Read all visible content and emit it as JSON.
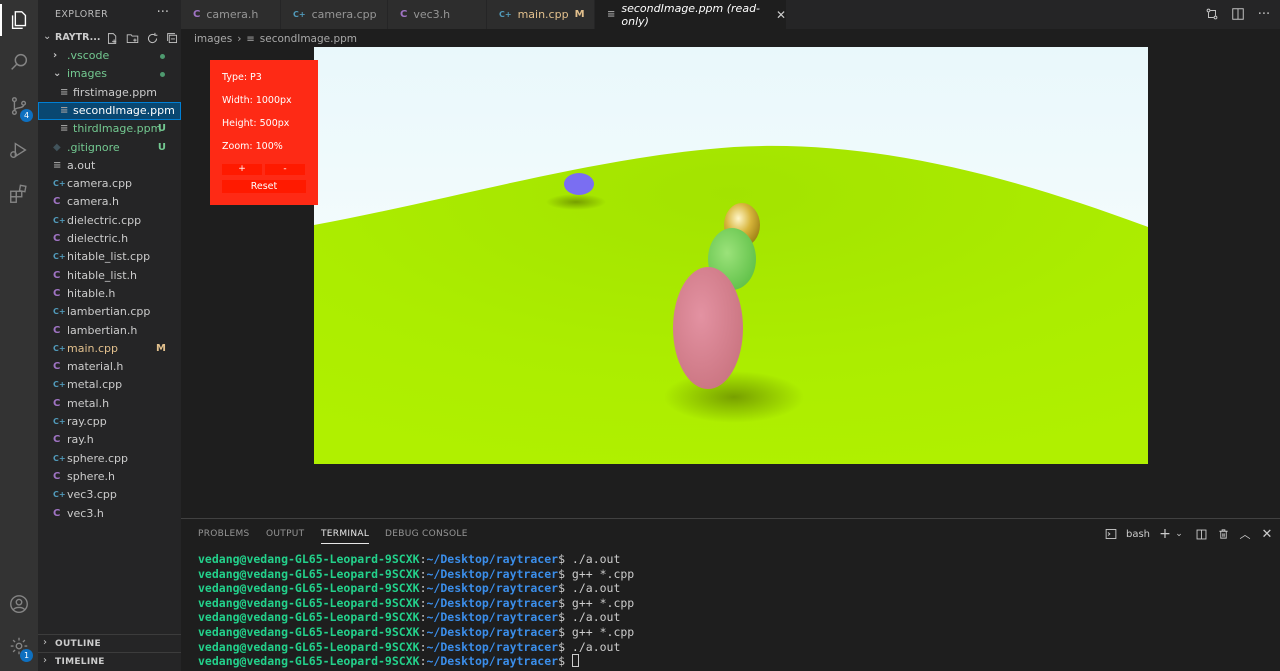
{
  "activity_bar": {
    "items": [
      {
        "icon": "files-icon"
      },
      {
        "icon": "search-icon"
      },
      {
        "icon": "source-control-icon",
        "badge": "4"
      },
      {
        "icon": "run-debug-icon"
      },
      {
        "icon": "extensions-icon"
      }
    ],
    "account_icon": "account-icon",
    "settings_icon": "settings-gear-icon",
    "settings_badge": "1"
  },
  "sidebar": {
    "title": "EXPLORER",
    "more": "···",
    "project": "RAYTR...",
    "outline": "OUTLINE",
    "timeline": "TIMELINE",
    "tree": [
      {
        "label": ".vscode",
        "type": "folder",
        "indent": 1,
        "status": "dot",
        "color": "#73c991"
      },
      {
        "label": "images",
        "type": "folder-open",
        "indent": 1,
        "status": "dot",
        "color": "#73c991"
      },
      {
        "label": "firstimage.ppm",
        "type": "file",
        "indent": 2,
        "status": "",
        "color": "#cccccc"
      },
      {
        "label": "secondImage.ppm",
        "type": "file",
        "indent": 2,
        "status": "",
        "color": "#ffffff",
        "selected": true
      },
      {
        "label": "thirdImage.ppm",
        "type": "file",
        "indent": 2,
        "status": "U",
        "color": "#73c991"
      },
      {
        "label": ".gitignore",
        "type": "gitignore",
        "indent": 1,
        "status": "U",
        "color": "#73c991"
      },
      {
        "label": "a.out",
        "type": "file",
        "indent": 1,
        "status": "",
        "color": "#cccccc"
      },
      {
        "label": "camera.cpp",
        "type": "cpp",
        "indent": 1,
        "status": "",
        "color": "#cccccc"
      },
      {
        "label": "camera.h",
        "type": "c",
        "indent": 1,
        "status": "",
        "color": "#cccccc"
      },
      {
        "label": "dielectric.cpp",
        "type": "cpp",
        "indent": 1,
        "status": "",
        "color": "#cccccc"
      },
      {
        "label": "dielectric.h",
        "type": "c",
        "indent": 1,
        "status": "",
        "color": "#cccccc"
      },
      {
        "label": "hitable_list.cpp",
        "type": "cpp",
        "indent": 1,
        "status": "",
        "color": "#cccccc"
      },
      {
        "label": "hitable_list.h",
        "type": "c",
        "indent": 1,
        "status": "",
        "color": "#cccccc"
      },
      {
        "label": "hitable.h",
        "type": "c",
        "indent": 1,
        "status": "",
        "color": "#cccccc"
      },
      {
        "label": "lambertian.cpp",
        "type": "cpp",
        "indent": 1,
        "status": "",
        "color": "#cccccc"
      },
      {
        "label": "lambertian.h",
        "type": "c",
        "indent": 1,
        "status": "",
        "color": "#cccccc"
      },
      {
        "label": "main.cpp",
        "type": "cpp",
        "indent": 1,
        "status": "M",
        "color": "#e2c08d"
      },
      {
        "label": "material.h",
        "type": "c",
        "indent": 1,
        "status": "",
        "color": "#cccccc"
      },
      {
        "label": "metal.cpp",
        "type": "cpp",
        "indent": 1,
        "status": "",
        "color": "#cccccc"
      },
      {
        "label": "metal.h",
        "type": "c",
        "indent": 1,
        "status": "",
        "color": "#cccccc"
      },
      {
        "label": "ray.cpp",
        "type": "cpp",
        "indent": 1,
        "status": "",
        "color": "#cccccc"
      },
      {
        "label": "ray.h",
        "type": "c",
        "indent": 1,
        "status": "",
        "color": "#cccccc"
      },
      {
        "label": "sphere.cpp",
        "type": "cpp",
        "indent": 1,
        "status": "",
        "color": "#cccccc"
      },
      {
        "label": "sphere.h",
        "type": "c",
        "indent": 1,
        "status": "",
        "color": "#cccccc"
      },
      {
        "label": "vec3.cpp",
        "type": "cpp",
        "indent": 1,
        "status": "",
        "color": "#cccccc"
      },
      {
        "label": "vec3.h",
        "type": "c",
        "indent": 1,
        "status": "",
        "color": "#cccccc"
      }
    ]
  },
  "tabs": [
    {
      "label": "camera.h",
      "type": "c",
      "active": false,
      "modified": ""
    },
    {
      "label": "camera.cpp",
      "type": "cpp",
      "active": false,
      "modified": ""
    },
    {
      "label": "vec3.h",
      "type": "c",
      "active": false,
      "modified": ""
    },
    {
      "label": "main.cpp",
      "type": "cpp",
      "active": false,
      "modified": "M"
    },
    {
      "label": "secondImage.ppm (read-only)",
      "type": "file",
      "active": true,
      "modified": ""
    }
  ],
  "breadcrumb": {
    "folder": "images",
    "file": "secondImage.ppm"
  },
  "image_info": {
    "type": "Type: P3",
    "width": "Width: 1000px",
    "height": "Height: 500px",
    "zoom": "Zoom: 100%",
    "zoom_in": "+",
    "zoom_out": "-",
    "reset": "Reset"
  },
  "scene_colors": {
    "sky": "#ffffff",
    "ground": "#acef00",
    "pink_sphere": "#d98494",
    "green_sphere": "#7bd45e",
    "gold_sphere": "#d4b033",
    "purple_sphere": "#7b6ef0"
  },
  "panel": {
    "tabs": [
      "PROBLEMS",
      "OUTPUT",
      "TERMINAL",
      "DEBUG CONSOLE"
    ],
    "active_tab": "TERMINAL",
    "shell": "bash"
  },
  "terminal": {
    "user": "vedang@vedang-GL65-Leopard-9SCXK",
    "path": "~/Desktop/raytracer",
    "lines": [
      "./a.out",
      "g++ *.cpp",
      "./a.out",
      "g++ *.cpp",
      "./a.out",
      "g++ *.cpp",
      "./a.out",
      ""
    ]
  }
}
